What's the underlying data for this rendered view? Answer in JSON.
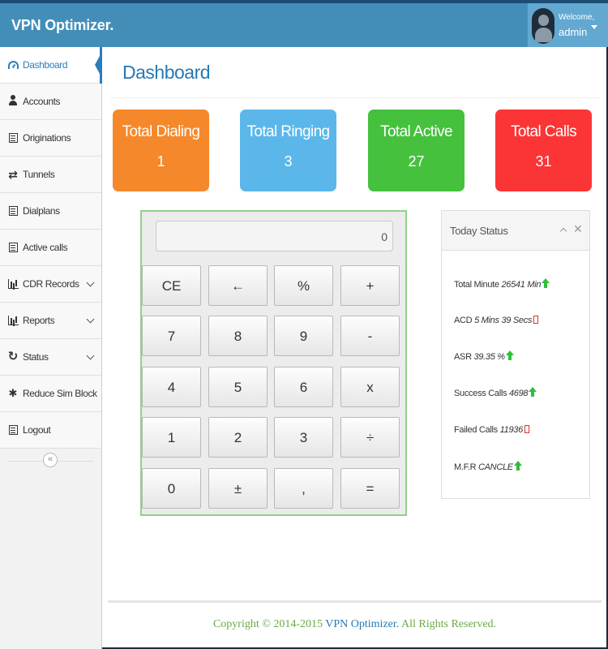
{
  "header": {
    "brand": "VPN Optimizer.",
    "welcome": "Welcome,",
    "username": "admin"
  },
  "sidebar": {
    "items": [
      {
        "label": "Dashboard",
        "icon": "dashboard-icon",
        "active": true
      },
      {
        "label": "Accounts",
        "icon": "user-icon"
      },
      {
        "label": "Originations",
        "icon": "list-icon"
      },
      {
        "label": "Tunnels",
        "icon": "exchange-icon"
      },
      {
        "label": "Dialplans",
        "icon": "list-icon"
      },
      {
        "label": "Active calls",
        "icon": "list-icon"
      },
      {
        "label": "CDR Records",
        "icon": "bar-chart-icon",
        "has_submenu": true
      },
      {
        "label": "Reports",
        "icon": "bar-chart-icon",
        "has_submenu": true
      },
      {
        "label": "Status",
        "icon": "refresh-icon",
        "has_submenu": true
      },
      {
        "label": "Reduce Sim Block",
        "icon": "bug-icon"
      },
      {
        "label": "Logout",
        "icon": "list-icon"
      }
    ],
    "collapse_icon": "«"
  },
  "main": {
    "title": "Dashboard",
    "stats": [
      {
        "label": "Total Dialing",
        "value": "1",
        "color": "#f5882a"
      },
      {
        "label": "Total Ringing",
        "value": "3",
        "color": "#5bb7ea"
      },
      {
        "label": "Total Active",
        "value": "27",
        "color": "#45c13d"
      },
      {
        "label": "Total Calls",
        "value": "31",
        "color": "#fb3535"
      }
    ]
  },
  "calculator": {
    "display": "0",
    "keys": [
      [
        "CE",
        "←",
        "%",
        "+"
      ],
      [
        "7",
        "8",
        "9",
        "-"
      ],
      [
        "4",
        "5",
        "6",
        "x"
      ],
      [
        "1",
        "2",
        "3",
        "÷"
      ],
      [
        "0",
        "±",
        ",",
        "="
      ]
    ]
  },
  "today_status": {
    "title": "Today Status",
    "rows": [
      {
        "label": "Total Minute",
        "value": "26541 Min",
        "trend": "up"
      },
      {
        "label": "ACD",
        "value": "5 Mins 39 Secs",
        "trend": "down"
      },
      {
        "label": "ASR",
        "value": "39.35 %",
        "trend": "up"
      },
      {
        "label": "Success Calls",
        "value": "4698",
        "trend": "up"
      },
      {
        "label": "Failed Calls",
        "value": "11936",
        "trend": "down"
      },
      {
        "label": "M.F.R",
        "value": "CANCLE",
        "trend": "up"
      }
    ]
  },
  "footer": {
    "prefix": "Copyright © 2014-2015 ",
    "brand": "VPN Optimizer.",
    "suffix": " All Rights Reserved."
  }
}
